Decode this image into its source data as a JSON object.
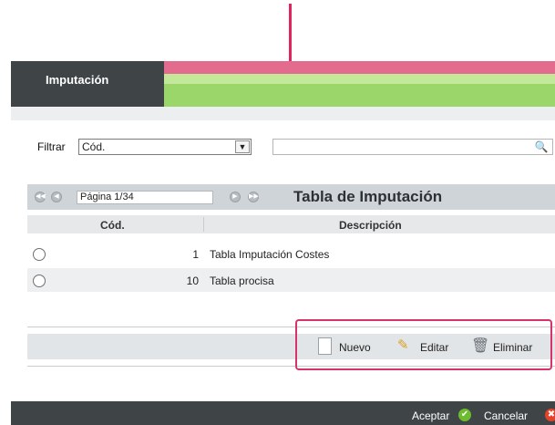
{
  "header": {
    "title": "Imputación"
  },
  "filter": {
    "label": "Filtrar",
    "selected": "Cód.",
    "search_value": ""
  },
  "table": {
    "page_label": "Página 1/34",
    "title": "Tabla de Imputación",
    "columns": [
      "Cód.",
      "Descripción"
    ],
    "rows": [
      {
        "code": "1",
        "description": "Tabla Imputación Costes"
      },
      {
        "code": "10",
        "description": "Tabla procisa"
      }
    ]
  },
  "toolbar": {
    "new_label": "Nuevo",
    "edit_label": "Editar",
    "delete_label": "Eliminar"
  },
  "footer": {
    "accept_label": "Aceptar",
    "cancel_label": "Cancelar"
  },
  "icons": {
    "nav": [
      "first-page-icon",
      "prev-page-icon",
      "next-page-icon",
      "last-page-icon"
    ],
    "toolbar": [
      "new-document-icon",
      "pencil-icon",
      "trash-icon"
    ],
    "footer": [
      "check-icon",
      "close-icon"
    ]
  },
  "colors": {
    "header_dark": "#3f4446",
    "header_pink": "#e36b8d",
    "header_green": "#9ad66a",
    "annotation": "#e0245e"
  }
}
